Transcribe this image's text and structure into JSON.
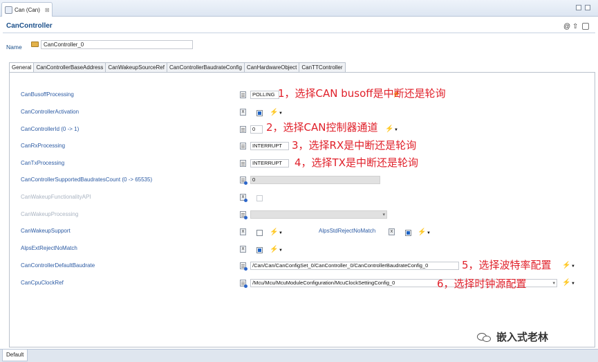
{
  "editor_tab": {
    "title": "Can (Can)",
    "close": "⊠"
  },
  "form": {
    "title": "CanController",
    "name_label": "Name",
    "name_value": "CanController_0"
  },
  "header_icons": {
    "help": "@",
    "up": "⇧"
  },
  "tabs": [
    "General",
    "CanControllerBaseAddress",
    "CanWakeupSourceRef",
    "CanControllerBaudrateConfig",
    "CanHardwareObject",
    "CanTTController"
  ],
  "params": {
    "busoff": {
      "label": "CanBusoffProcessing",
      "value": "POLLING"
    },
    "activation": {
      "label": "CanControllerActivation",
      "checked": true
    },
    "controller_id": {
      "label": "CanControllerId (0 -> 1)",
      "value": "0"
    },
    "rx": {
      "label": "CanRxProcessing",
      "value": "INTERRUPT"
    },
    "tx": {
      "label": "CanTxProcessing",
      "value": "INTERRUPT"
    },
    "baud_count": {
      "label": "CanControllerSupportedBaudratesCount (0 -> 65535)",
      "value": "0"
    },
    "wakeup_func": {
      "label": "CanWakeupFunctionalityAPI"
    },
    "wakeup_proc": {
      "label": "CanWakeupProcessing",
      "value": ""
    },
    "wakeup_support": {
      "label": "CanWakeupSupport",
      "checked": false
    },
    "std_reject": {
      "label": "AlpsStdRejectNoMatch",
      "checked": true
    },
    "ext_reject": {
      "label": "AlpsExtRejectNoMatch",
      "checked": true
    },
    "default_baud": {
      "label": "CanControllerDefaultBaudrate",
      "value": "/Can/Can/CanConfigSet_0/CanController_0/CanControllerBaudrateConfig_0"
    },
    "cpu_clock": {
      "label": "CanCpuClockRef",
      "value": "/Mcu/Mcu/McuModuleConfiguration/McuClockSettingConfig_0"
    }
  },
  "annotations": {
    "a1": "1，选择CAN busoff是中断还是轮询",
    "a2": "2，选择CAN控制器通道",
    "a3": "3，选择RX是中断还是轮询",
    "a4": "4，选择TX是中断还是轮询",
    "a5": "5，选择波特率配置",
    "a6": "6，选择时钟源配置"
  },
  "watermark": "嵌入式老林",
  "bottom_tab": "Default",
  "icons": {
    "wand": "wand-icon",
    "dropdown": "chevron-down-icon",
    "check": "checkbox-icon"
  },
  "colors": {
    "label_blue": "#2b5aa3",
    "title_blue": "#1a4f8a",
    "annotation_red": "#e0202a",
    "check_blue": "#1e63c4"
  }
}
